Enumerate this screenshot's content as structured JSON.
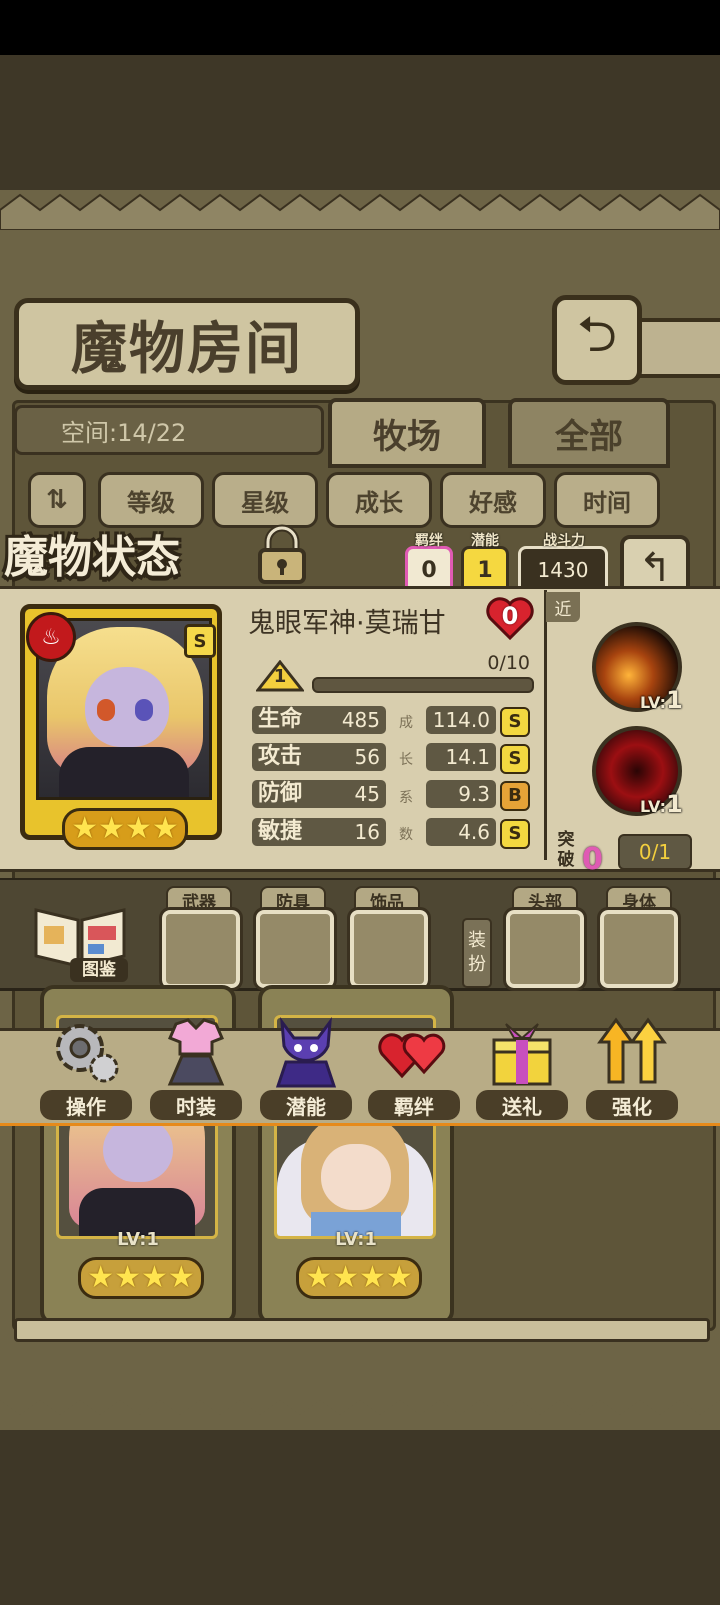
{
  "room": {
    "title": "魔物房间",
    "space": "空间:14/22",
    "tabs": [
      {
        "label": "牧场"
      },
      {
        "label": "全部"
      }
    ],
    "sort": [
      {
        "label": "等级"
      },
      {
        "label": "星级"
      },
      {
        "label": "成长"
      },
      {
        "label": "好感"
      },
      {
        "label": "时间"
      }
    ]
  },
  "status": {
    "title": "魔物状态",
    "bond": {
      "label": "羁绊",
      "value": "0"
    },
    "potential": {
      "label": "潜能",
      "value": "1"
    },
    "power": {
      "label": "战斗力",
      "value": "1430"
    },
    "name": "鬼眼军神·莫瑞甘",
    "affection": "0",
    "rank": "S",
    "level": "1",
    "xp": "0/10",
    "xp_fraction": 0,
    "star_count": 4,
    "growth_label": [
      "成",
      "长",
      "系",
      "数"
    ],
    "stats": [
      {
        "name": "生命",
        "value": "485",
        "growth": "114.0",
        "grade": "S"
      },
      {
        "name": "攻击",
        "value": "56",
        "growth": "14.1",
        "grade": "S"
      },
      {
        "name": "防御",
        "value": "45",
        "growth": "9.3",
        "grade": "B"
      },
      {
        "name": "敏捷",
        "value": "16",
        "growth": "4.6",
        "grade": "S"
      }
    ],
    "skill_tag": "近",
    "skills": [
      {
        "lv_prefix": "LV:",
        "lv": "1"
      },
      {
        "lv_prefix": "LV:",
        "lv": "1"
      }
    ],
    "breakthrough": {
      "label_top": "突",
      "label_bottom": "破",
      "count": "0",
      "progress": "0/1"
    }
  },
  "equip": {
    "book_label": "图鉴",
    "zhuang": [
      "装",
      "扮"
    ],
    "slots": [
      {
        "label": "武器"
      },
      {
        "label": "防具"
      },
      {
        "label": "饰品"
      },
      {
        "label": "头部"
      },
      {
        "label": "身体"
      }
    ]
  },
  "actions": [
    {
      "label": "操作",
      "icon": "gear-icon"
    },
    {
      "label": "时装",
      "icon": "outfit-icon"
    },
    {
      "label": "潜能",
      "icon": "potential-demon-icon"
    },
    {
      "label": "羁绊",
      "icon": "bond-hearts-icon"
    },
    {
      "label": "送礼",
      "icon": "gift-icon"
    },
    {
      "label": "强化",
      "icon": "upgrade-arrows-icon"
    }
  ],
  "cards": [
    {
      "lv": "LV:1",
      "stars": 4
    },
    {
      "lv": "LV:1",
      "stars": 4
    }
  ],
  "colors": {
    "gold": "#e8c32c",
    "parchment": "#d8ceae",
    "dark": "#3a3120",
    "pink": "#e05ab4"
  }
}
